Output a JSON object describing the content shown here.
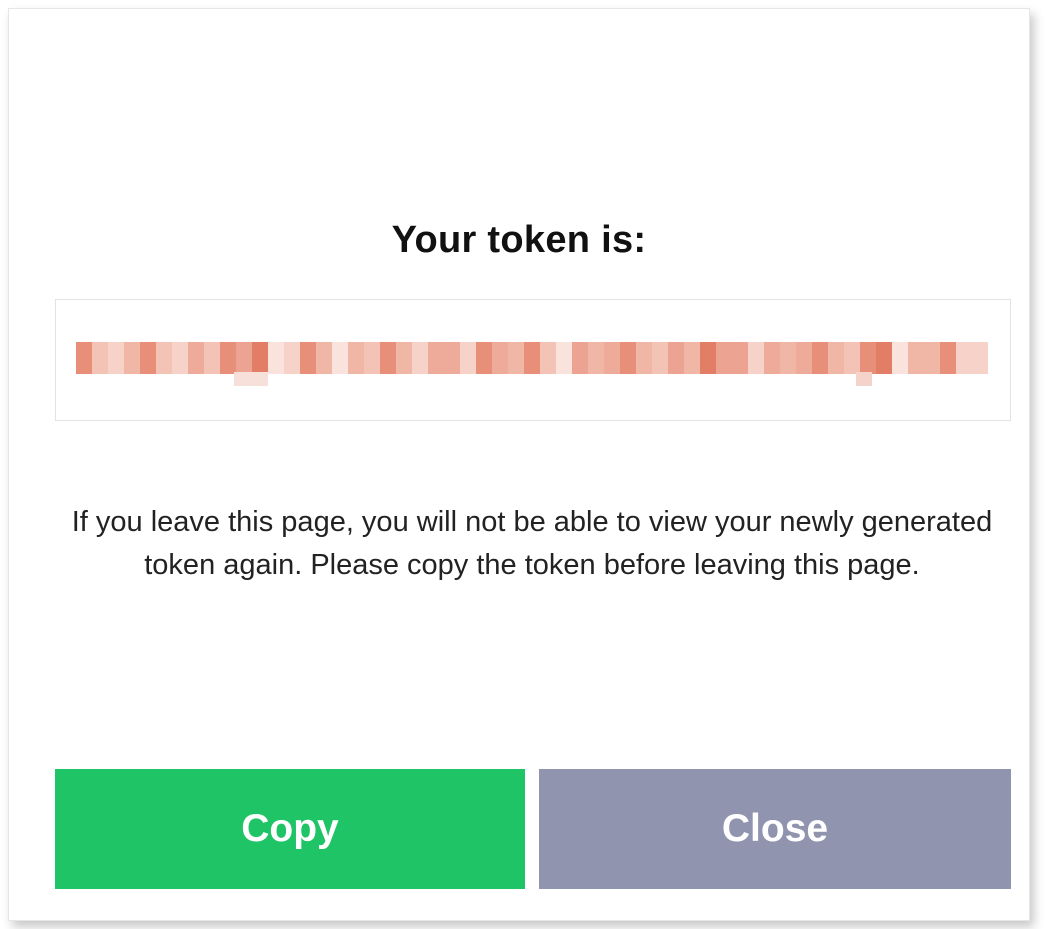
{
  "dialog": {
    "title": "Your token is:",
    "token": {
      "redacted": true,
      "redaction_color": "#ec9a85"
    },
    "message": "If you leave this page, you will not be able to view your newly generated token again. Please copy the token before leaving this page.",
    "buttons": {
      "copy_label": "Copy",
      "close_label": "Close"
    }
  },
  "colors": {
    "copy_button": "#1fc466",
    "close_button": "#9094ae",
    "title_text": "#111111",
    "body_text": "#222222"
  }
}
